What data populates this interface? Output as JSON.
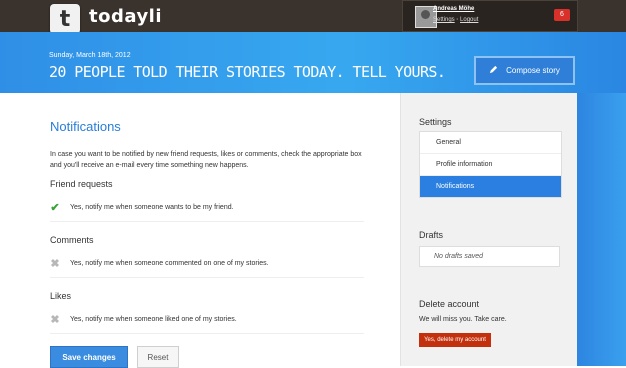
{
  "app": {
    "logo_letter": "t",
    "brand": "todayli"
  },
  "user": {
    "name": "Andreas Möhe",
    "settings_link": "Settings",
    "separator": "·",
    "logout_link": "Logout",
    "notification_count": "6"
  },
  "banner": {
    "date": "Sunday, March 18th, 2012",
    "headline": "20 PEOPLE TOLD THEIR STORIES TODAY. TELL YOURS.",
    "compose_icon": "pencil-icon",
    "compose_label": "Compose story"
  },
  "main": {
    "title": "Notifications",
    "intro": "In case you want to be notified by new friend requests, likes or comments, check the appropriate box and you'll receive an e-mail every time something new happens.",
    "sections": [
      {
        "heading": "Friend requests",
        "option": "Yes, notify me when someone wants to be my friend.",
        "checked": true
      },
      {
        "heading": "Comments",
        "option": "Yes, notify me when someone commented on one of my stories.",
        "checked": false
      },
      {
        "heading": "Likes",
        "option": "Yes, notify me when someone liked one of my stories.",
        "checked": false
      }
    ],
    "save_label": "Save changes",
    "reset_label": "Reset"
  },
  "sidebar": {
    "settings_heading": "Settings",
    "nav": [
      {
        "label": "General",
        "active": false
      },
      {
        "label": "Profile information",
        "active": false
      },
      {
        "label": "Notifications",
        "active": true
      }
    ],
    "drafts_heading": "Drafts",
    "drafts_empty": "No drafts saved",
    "delete_heading": "Delete account",
    "delete_text": "We will miss you. Take care.",
    "delete_button": "Yes, delete my account"
  },
  "colors": {
    "accent": "#2a7fe0",
    "topbar": "#3a322c",
    "danger": "#c2300d",
    "check": "#3aa339"
  }
}
